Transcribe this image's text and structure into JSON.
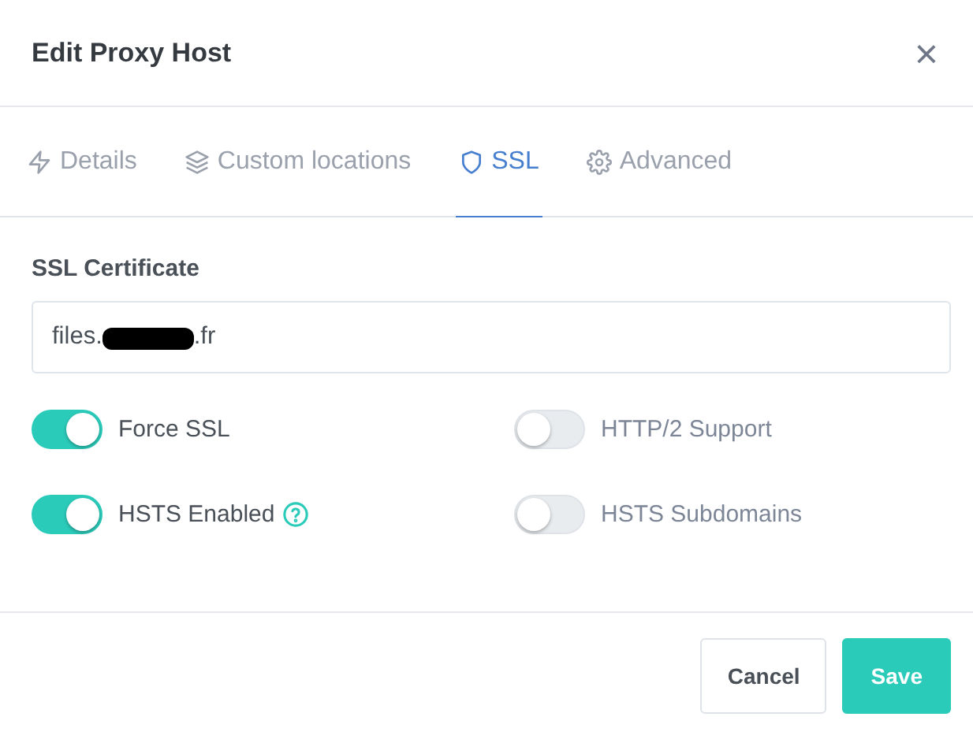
{
  "dialog": {
    "title": "Edit Proxy Host",
    "close": "×"
  },
  "tabs": [
    {
      "label": "Details",
      "kind": "bolt",
      "selected": false
    },
    {
      "label": "Custom locations",
      "kind": "layers",
      "selected": false
    },
    {
      "label": "SSL",
      "kind": "shield",
      "selected": true
    },
    {
      "label": "Advanced",
      "kind": "gear",
      "selected": false
    }
  ],
  "certificate": {
    "label": "SSL Certificate",
    "value_start": "files.",
    "redacted": true,
    "value_end": ".fr"
  },
  "toggles": [
    {
      "label": "Force SSL",
      "on": true,
      "help": false
    },
    {
      "label": "HTTP/2 Support",
      "on": false,
      "help": false
    },
    {
      "label": "HSTS Enabled",
      "on": true,
      "help": true
    },
    {
      "label": "HSTS Subdomains",
      "on": false,
      "help": false
    }
  ],
  "buttons": [
    {
      "label": "Cancel",
      "kind": "secondary"
    },
    {
      "label": "Save",
      "kind": "primary"
    }
  ]
}
